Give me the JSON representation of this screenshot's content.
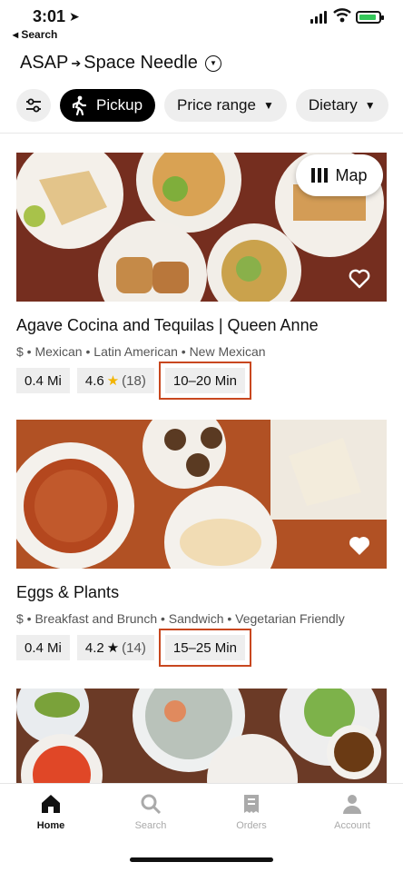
{
  "status_bar": {
    "time": "3:01",
    "back_label": "◂ Search"
  },
  "header": {
    "when": "ASAP",
    "destination": "Space Needle"
  },
  "filters": {
    "pickup": "Pickup",
    "price_range": "Price range",
    "dietary": "Dietary"
  },
  "map_button": {
    "label": "Map"
  },
  "restaurants": [
    {
      "name": "Agave Cocina and Tequilas | Queen Anne",
      "meta": "$ • Mexican • Latin American • New Mexican",
      "distance": "0.4 Mi",
      "rating": "4.6",
      "reviews": "(18)",
      "time": "10–20 Min",
      "star_color": "#f2b400"
    },
    {
      "name": "Eggs & Plants",
      "meta": "$ • Breakfast and Brunch • Sandwich • Vegetarian Friendly",
      "distance": "0.4 Mi",
      "rating": "4.2",
      "reviews": "(14)",
      "time": "15–25 Min",
      "star_color": "#111111"
    }
  ],
  "bottom_nav": {
    "home": "Home",
    "search": "Search",
    "orders": "Orders",
    "account": "Account"
  },
  "colors": {
    "highlight": "#c8471f",
    "chip_bg": "#eeeeee"
  }
}
